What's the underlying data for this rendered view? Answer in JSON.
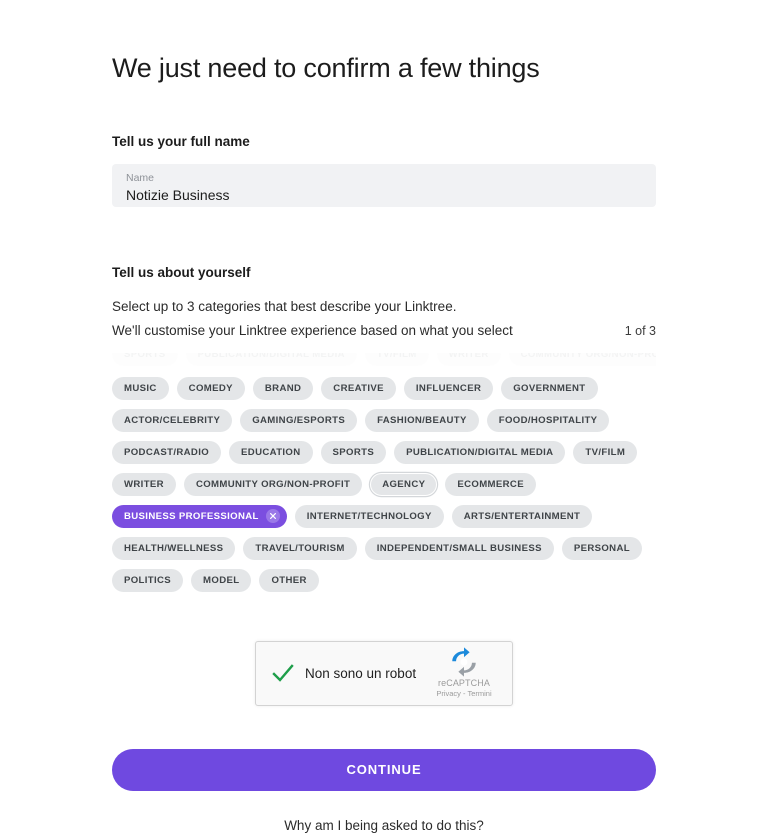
{
  "page": {
    "title": "We just need to confirm a few things"
  },
  "name_section": {
    "heading": "Tell us your full name",
    "field_label": "Name",
    "field_value": "Notizie Business",
    "field_placeholder": "Name"
  },
  "about_section": {
    "heading": "Tell us about yourself",
    "description_line_1": "Select up to 3 categories that best describe your Linktree.",
    "description_line_2": "We'll customise your Linktree experience based on what you select",
    "counter": "1 of 3"
  },
  "categories": [
    {
      "label": "MUSIC",
      "selected": false,
      "focused": false
    },
    {
      "label": "COMEDY",
      "selected": false,
      "focused": false
    },
    {
      "label": "BRAND",
      "selected": false,
      "focused": false
    },
    {
      "label": "CREATIVE",
      "selected": false,
      "focused": false
    },
    {
      "label": "INFLUENCER",
      "selected": false,
      "focused": false
    },
    {
      "label": "GOVERNMENT",
      "selected": false,
      "focused": false
    },
    {
      "label": "ACTOR/CELEBRITY",
      "selected": false,
      "focused": false
    },
    {
      "label": "GAMING/ESPORTS",
      "selected": false,
      "focused": false
    },
    {
      "label": "FASHION/BEAUTY",
      "selected": false,
      "focused": false
    },
    {
      "label": "FOOD/HOSPITALITY",
      "selected": false,
      "focused": false
    },
    {
      "label": "PODCAST/RADIO",
      "selected": false,
      "focused": false
    },
    {
      "label": "EDUCATION",
      "selected": false,
      "focused": false
    },
    {
      "label": "SPORTS",
      "selected": false,
      "focused": false
    },
    {
      "label": "PUBLICATION/DIGITAL MEDIA",
      "selected": false,
      "focused": false
    },
    {
      "label": "TV/FILM",
      "selected": false,
      "focused": false
    },
    {
      "label": "WRITER",
      "selected": false,
      "focused": false
    },
    {
      "label": "COMMUNITY ORG/NON-PROFIT",
      "selected": false,
      "focused": false
    },
    {
      "label": "AGENCY",
      "selected": false,
      "focused": true
    },
    {
      "label": "ECOMMERCE",
      "selected": false,
      "focused": false
    },
    {
      "label": "BUSINESS PROFESSIONAL",
      "selected": true,
      "focused": false
    },
    {
      "label": "INTERNET/TECHNOLOGY",
      "selected": false,
      "focused": false
    },
    {
      "label": "ARTS/ENTERTAINMENT",
      "selected": false,
      "focused": false
    },
    {
      "label": "HEALTH/WELLNESS",
      "selected": false,
      "focused": false
    },
    {
      "label": "TRAVEL/TOURISM",
      "selected": false,
      "focused": false
    },
    {
      "label": "INDEPENDENT/SMALL BUSINESS",
      "selected": false,
      "focused": false
    },
    {
      "label": "PERSONAL",
      "selected": false,
      "focused": false
    },
    {
      "label": "POLITICS",
      "selected": false,
      "focused": false
    },
    {
      "label": "MODEL",
      "selected": false,
      "focused": false
    },
    {
      "label": "OTHER",
      "selected": false,
      "focused": false
    }
  ],
  "faded_categories": [
    "SPORTS",
    "PUBLICATION/DIGITAL MEDIA",
    "TV/FILM",
    "WRITER",
    "COMMUNITY ORG/NON-PROFIT"
  ],
  "recaptcha": {
    "label": "Non sono un robot",
    "brand_name": "reCAPTCHA",
    "links": "Privacy - Termini",
    "checked": true
  },
  "actions": {
    "continue_label": "CONTINUE",
    "help_link_label": "Why am I being asked to do this?"
  },
  "colors": {
    "accent": "#6f49e0",
    "chip_selected": "#7b4ee0",
    "chip_default": "#e4e6e8",
    "field_bg": "#f1f2f4",
    "check_green": "#1e9e4a"
  }
}
